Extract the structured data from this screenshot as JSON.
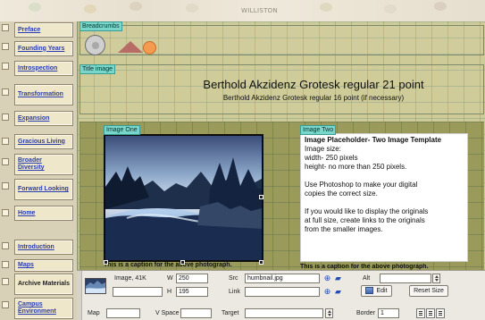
{
  "page": {
    "top_strip_text": "WILLISTON"
  },
  "sidebar": {
    "items": [
      {
        "label": "Preface",
        "link": true
      },
      {
        "label": "Founding Years",
        "link": true
      },
      {
        "label": "Introspection",
        "link": true
      },
      {
        "label": "Transformation",
        "link": true
      },
      {
        "label": "Expansion",
        "link": true
      },
      {
        "label": "Gracious Living",
        "link": true
      },
      {
        "label": "Broader Diversity",
        "link": true
      },
      {
        "label": "Forward Looking",
        "link": true
      },
      {
        "label": "Home",
        "link": true
      },
      {
        "label": "Introduction",
        "link": true
      },
      {
        "label": "Maps",
        "link": true
      },
      {
        "label": "Archive Materials",
        "link": false
      },
      {
        "label": "Campus Environment",
        "link": true
      }
    ]
  },
  "content": {
    "breadcrumbs_label": "Breadcrumbs",
    "title_image_label": "Title image",
    "headline": "Berthold Akzidenz Grotesk regular 21 point",
    "subheadline": "Berthold Akzidenz Grotesk regular 16 point (if necessary)",
    "image_one": {
      "label": "Image One",
      "caption": "This is a caption for the above photograph."
    },
    "image_two": {
      "label": "Image Two",
      "title": "Image Placeholder- Two Image Template",
      "size_heading": "Image size:",
      "width_line": "width- 250 pixels",
      "height_line": "height- no more than 250 pixels.",
      "photoshop_line_1": "Use Photoshop to make your digital",
      "photoshop_line_2": "copies the correct size.",
      "fullsize_line_1": "If you would like to display the originals",
      "fullsize_line_2": "at full size, create links to the originals",
      "fullsize_line_3": "from the smaller images.",
      "caption": "This is a caption for the above photograph."
    }
  },
  "properties": {
    "image_label": "Image, 41K",
    "w_label": "W",
    "w_value": "250",
    "h_label": "H",
    "h_value": "195",
    "src_label": "Src",
    "src_value": "humbnail.jpg",
    "link_label": "Link",
    "link_value": "",
    "alt_label": "Alt",
    "alt_value": "",
    "edit_label": "Edit",
    "reset_size_label": "Reset Size",
    "map_label": "Map",
    "vspace_label": "V Space",
    "target_label": "Target",
    "border_label": "Border",
    "border_value": "1"
  },
  "colors": {
    "link_blue": "#2b3db0",
    "region_label_bg": "#79d6cb",
    "content_bg": "#cfcb98",
    "content_dark_bg": "#9a9b5a",
    "properties_bg": "#ece9e2",
    "triangle": "#b76d66",
    "orange_circle": "#f49b50"
  },
  "icons": {
    "breadcrumb_shapes": [
      "grey-circle-icon",
      "triangle-icon",
      "orange-circle-icon"
    ],
    "src_icons": [
      "point-to-file-icon",
      "folder-icon"
    ],
    "link_icons": [
      "point-to-file-icon",
      "folder-icon"
    ],
    "edit_icon": "edit-icon",
    "align_icons": [
      "align-left-icon",
      "align-center-icon",
      "align-right-icon"
    ]
  }
}
